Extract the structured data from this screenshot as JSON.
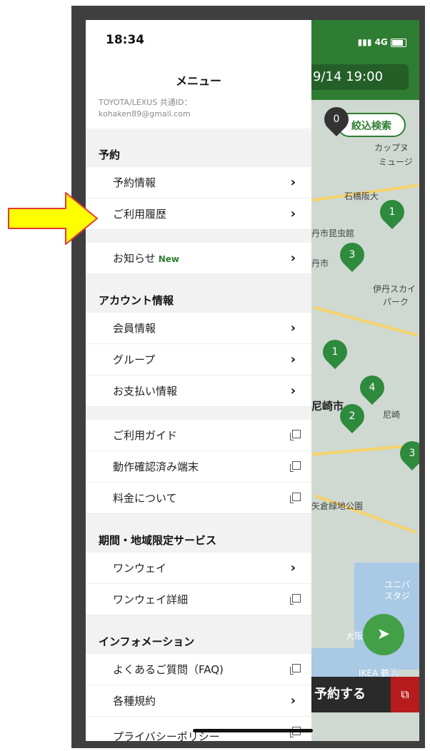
{
  "status": {
    "time": "18:34",
    "network": "4G"
  },
  "menu": {
    "title": "メニュー",
    "account_line1": "TOYOTA/LEXUS 共通ID：",
    "account_line2": "kohaken89@gmail.com",
    "sections": {
      "reservation": {
        "title": "予約",
        "items": [
          "予約情報",
          "ご利用履歴"
        ]
      },
      "news": {
        "label": "お知らせ",
        "badge": "New"
      },
      "account": {
        "title": "アカウント情報",
        "items": [
          "会員情報",
          "グループ",
          "お支払い情報"
        ]
      },
      "guides": {
        "items": [
          "ご利用ガイド",
          "動作確認済み端末",
          "料金について"
        ]
      },
      "limited": {
        "title": "期間・地域限定サービス",
        "items": [
          "ワンウェイ",
          "ワンウェイ詳細"
        ]
      },
      "info": {
        "title": "インフォメーション",
        "items": [
          "よくあるご質問（FAQ)",
          "各種規約",
          "プライバシーポリシー"
        ]
      }
    }
  },
  "map": {
    "datetime": "9/14 19:00",
    "filter_label": "絞込検索",
    "pins": [
      "0",
      "1",
      "3",
      "1",
      "4",
      "2",
      "3"
    ],
    "labels": {
      "cup": "カップヌ",
      "museum": "ミュージ",
      "ishibashi": "石橋阪大",
      "konchu": "丹市昆虫館",
      "itami_city": "丹市",
      "itami_sky": "伊丹スカイ",
      "park": "パーク",
      "amagasaki": "尼崎市",
      "amagasaki2": "尼崎",
      "yagura": "矢倉緑地公園",
      "universal": "ユニバ",
      "studio": "スタジ",
      "osaka": "大阪",
      "ikea": "IKEA 鶴浜"
    },
    "reserve_label": "予約する"
  },
  "colors": {
    "brand_green": "#2e7d32",
    "arrow_yellow": "#ffff00",
    "arrow_border": "#e53935"
  }
}
